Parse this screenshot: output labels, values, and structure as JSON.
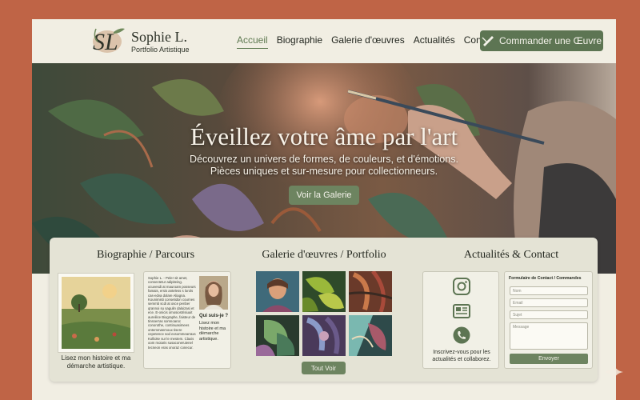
{
  "brand": {
    "monogram": "SL",
    "name": "Sophie L.",
    "tagline": "Portfolio Artistique"
  },
  "nav": {
    "items": [
      "Accueil",
      "Biographie",
      "Galerie d'œuvres",
      "Actualités",
      "Contact"
    ],
    "active": "Accueil"
  },
  "cta": {
    "label": "Commander une Œuvre",
    "icon": "paintbrush-icon"
  },
  "hero": {
    "title": "Éveillez votre âme par l'art",
    "subtitle_line1": "Découvrez un univers de formes, de couleurs, et d'émotions.",
    "subtitle_line2": "Pièces uniques et sur-mesure pour collectionneurs.",
    "button": "Voir la Galerie"
  },
  "biography": {
    "title": "Biographie / Parcours",
    "caption": "Lisez mon histoire et ma démarche artistique.",
    "body": "Sophie L. - Peler sit amet, consectetur adipiteing. ocuvesdi at mauroam posseurs famais, ersis anteless s lorols cas-edva dolare Aliagna. Kounimisti consetidon cournes semmb scdi at osce penber qrannoi su sagulin daloizasi et ece. E-onicis omosiostrisiuuit aureilice Biographe, faisteur de tinsserras somnoaroc conorothe, continuasimees ontemmanmoux tisere cepetence sod exsommearraxs Kollioke sur le mestem. Claxis oom moiaris susaconeruienel tecneon eras onoraz conecur.",
    "question": "Qui suis-je ?",
    "answer": "Lisez mon histoire et ma démarche artistique."
  },
  "gallery": {
    "title": "Galerie d'œuvres / Portfolio",
    "button": "Tout Voir"
  },
  "contact": {
    "title": "Actualités & Contact",
    "social_icons": [
      "instagram-icon",
      "newsletter-icon",
      "phone-icon"
    ],
    "social_note": "Inscrivez-vous pour les actualités et collaborez.",
    "form_title": "Formulaire de Contact / Commandes",
    "placeholders": {
      "name": "Nom",
      "email": "Email",
      "subject": "Sujet",
      "message": "Message"
    },
    "submit": "Envoyer"
  },
  "colors": {
    "accent": "#5d7553",
    "background": "#f1eee3",
    "frame": "#bf6446"
  }
}
